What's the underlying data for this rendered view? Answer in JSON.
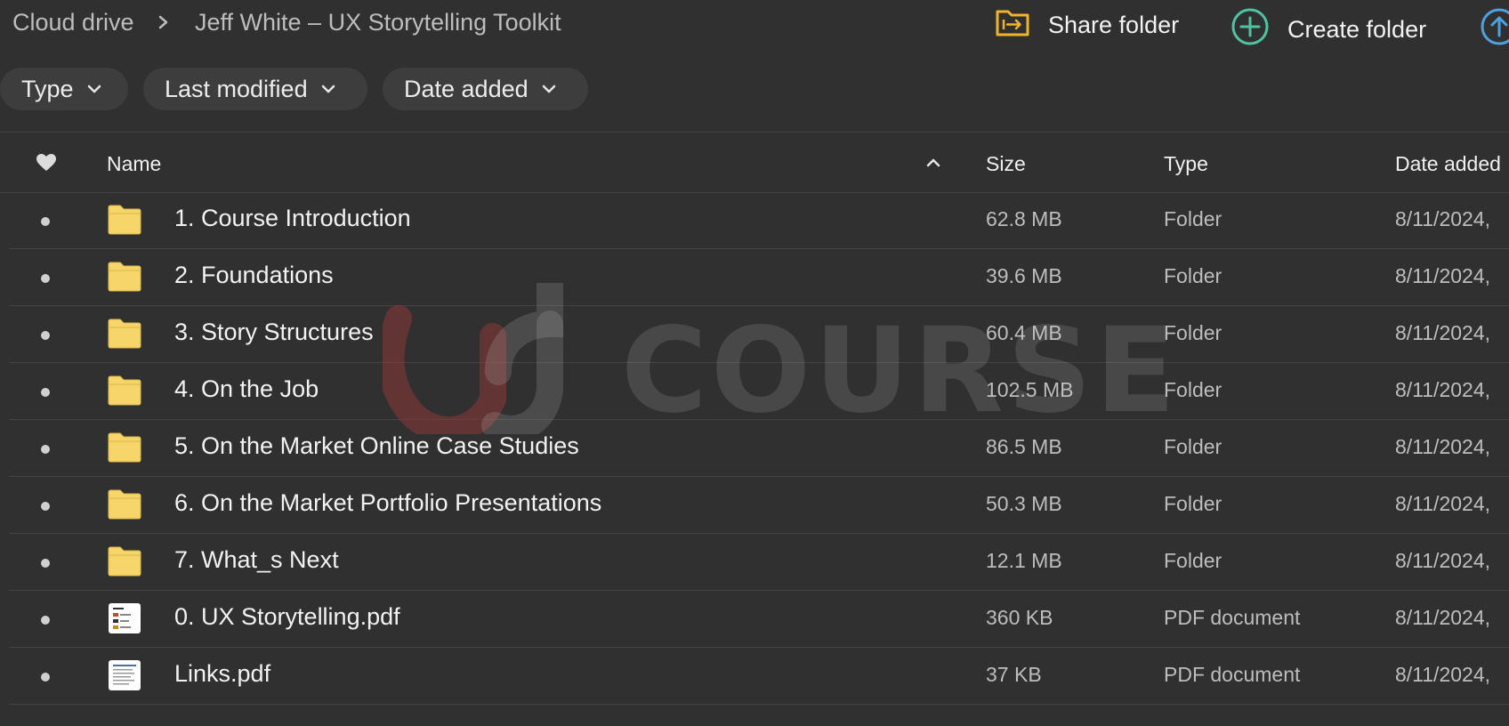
{
  "breadcrumb": {
    "root": "Cloud drive",
    "current": "Jeff White – UX Storytelling Toolkit"
  },
  "actions": {
    "share_label": "Share folder",
    "create_label": "Create folder"
  },
  "filters": [
    {
      "label": "Type"
    },
    {
      "label": "Last modified"
    },
    {
      "label": "Date added"
    }
  ],
  "table": {
    "headers": {
      "name": "Name",
      "size": "Size",
      "type": "Type",
      "date": "Date added"
    },
    "rows": [
      {
        "name": "1. Course Introduction",
        "size": "62.8 MB",
        "type": "Folder",
        "date": "8/11/2024,",
        "icon": "folder-icon"
      },
      {
        "name": "2. Foundations",
        "size": "39.6 MB",
        "type": "Folder",
        "date": "8/11/2024,",
        "icon": "folder-icon"
      },
      {
        "name": "3. Story Structures",
        "size": "60.4 MB",
        "type": "Folder",
        "date": "8/11/2024,",
        "icon": "folder-icon"
      },
      {
        "name": "4. On the Job",
        "size": "102.5 MB",
        "type": "Folder",
        "date": "8/11/2024,",
        "icon": "folder-icon"
      },
      {
        "name": "5. On the Market Online Case Studies",
        "size": "86.5 MB",
        "type": "Folder",
        "date": "8/11/2024,",
        "icon": "folder-icon"
      },
      {
        "name": "6. On the Market Portfolio Presentations",
        "size": "50.3 MB",
        "type": "Folder",
        "date": "8/11/2024,",
        "icon": "folder-icon"
      },
      {
        "name": "7. What_s Next",
        "size": "12.1 MB",
        "type": "Folder",
        "date": "8/11/2024,",
        "icon": "folder-icon"
      },
      {
        "name": "0. UX Storytelling.pdf",
        "size": "360 KB",
        "type": "PDF document",
        "date": "8/11/2024,",
        "icon": "pdf-thumbnail-icon"
      },
      {
        "name": "Links.pdf",
        "size": "37 KB",
        "type": "PDF document",
        "date": "8/11/2024,",
        "icon": "pdf-thumbnail-icon"
      }
    ]
  },
  "watermark": {
    "text": "COURSE"
  },
  "colors": {
    "background": "#303030",
    "folder_yellow": "#f6d66b",
    "share_accent": "#f0b429",
    "create_accent": "#4fc3a1",
    "upload_accent": "#4aa3df"
  }
}
